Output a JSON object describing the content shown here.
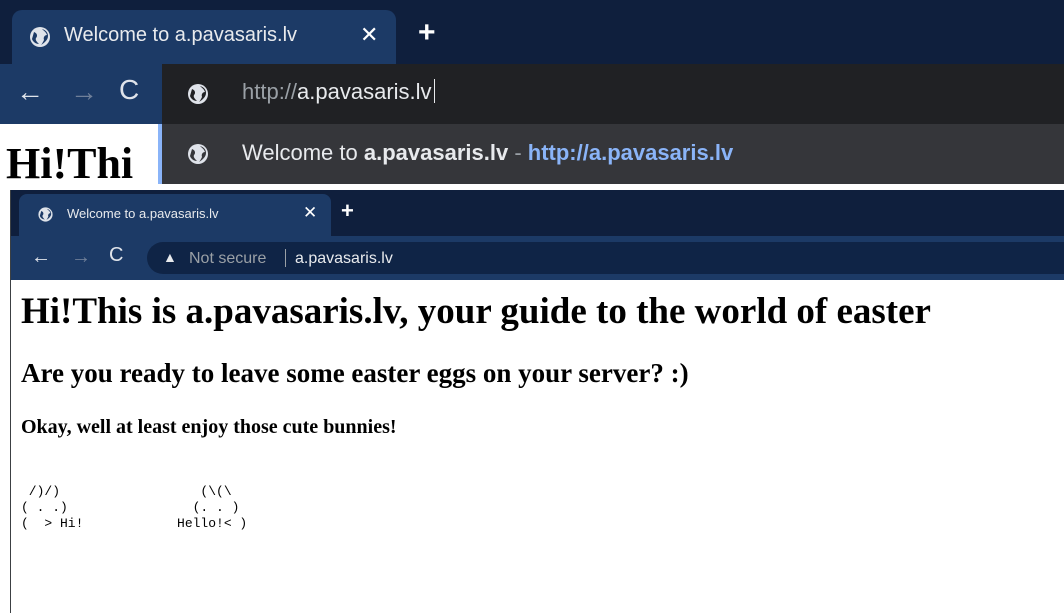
{
  "top_window": {
    "tab": {
      "title": "Welcome to a.pavasaris.lv",
      "close": "✕"
    },
    "new_tab": "+",
    "nav": {
      "back": "←",
      "forward": "→",
      "reload": "C"
    },
    "omnibox": {
      "scheme": "http://",
      "host": "a.pavasaris.lv"
    },
    "suggestion": {
      "prefix": "Welcome to ",
      "bold_host": "a.pavasaris.lv",
      "separator": " - ",
      "url": "http://a.pavasaris.lv"
    },
    "page_heading_partial": "Hi!Thi"
  },
  "bottom_window": {
    "tab": {
      "title": "Welcome to a.pavasaris.lv",
      "close": "✕"
    },
    "new_tab": "+",
    "nav": {
      "back": "←",
      "forward": "→",
      "reload": "C"
    },
    "omnibox": {
      "warning_icon": "▲",
      "security_label": "Not secure",
      "url": "a.pavasaris.lv"
    },
    "page": {
      "h1": "Hi!This is a.pavasaris.lv, your guide to the world of easter",
      "h2": "Are you ready to leave some easter eggs on your server? :)",
      "h3": "Okay, well at least enjoy those cute bunnies!",
      "ascii_art": " /)/)                  (\\(\\\n( . .)                (. . )\n(  > Hi!            Hello!< )"
    }
  },
  "icons": [
    "globe-icon",
    "close-icon",
    "plus-icon",
    "back-arrow-icon",
    "forward-arrow-icon",
    "reload-icon",
    "warning-icon"
  ],
  "colors": {
    "tabstrip": "#0f1f3d",
    "active_tab": "#1c3a66",
    "omnibox_dark": "#202124",
    "suggestion_bg": "#35363a",
    "link_blue": "#8ab4f8",
    "text_light": "#e8eaed",
    "text_muted": "#9aa0a6"
  }
}
